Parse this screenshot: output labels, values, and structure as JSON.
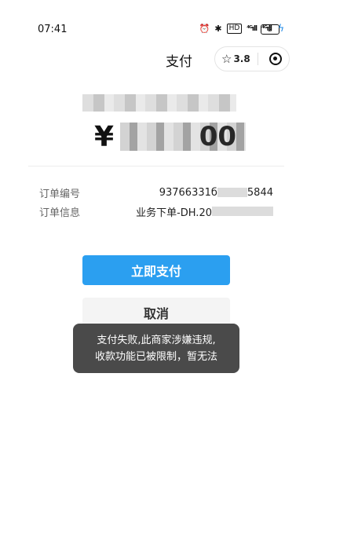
{
  "status_bar": {
    "time": "07:41",
    "alarm_icon": "alarm-icon",
    "bluetooth_icon": "bluetooth-icon",
    "hd_tag": "HD",
    "signal_1": "⁴ᴳıll",
    "signal_2": "⁴ᴳıll",
    "battery_level": "2",
    "charging_icon": "charging-icon"
  },
  "header": {
    "title": "支付",
    "rating": "3.8",
    "star_icon": "star-outline-icon",
    "target_icon": "target-icon"
  },
  "payment": {
    "currency": "¥",
    "amount_visible_tail": "00"
  },
  "order_info": {
    "number_label": "订单编号",
    "number_value_prefix": "93766331б",
    "number_value_suffix": "5844",
    "info_label": "订单信息",
    "info_value_prefix": "业务下单-DH.20"
  },
  "buttons": {
    "pay": "立即支付",
    "cancel": "取消"
  },
  "toast": {
    "line1": "支付失败,此商家涉嫌违规,",
    "line2": "收款功能已被限制，暂无法"
  },
  "colors": {
    "primary": "#2b9ff0",
    "toast_bg": "#4a4a4a",
    "charge": "#1e88e5"
  }
}
